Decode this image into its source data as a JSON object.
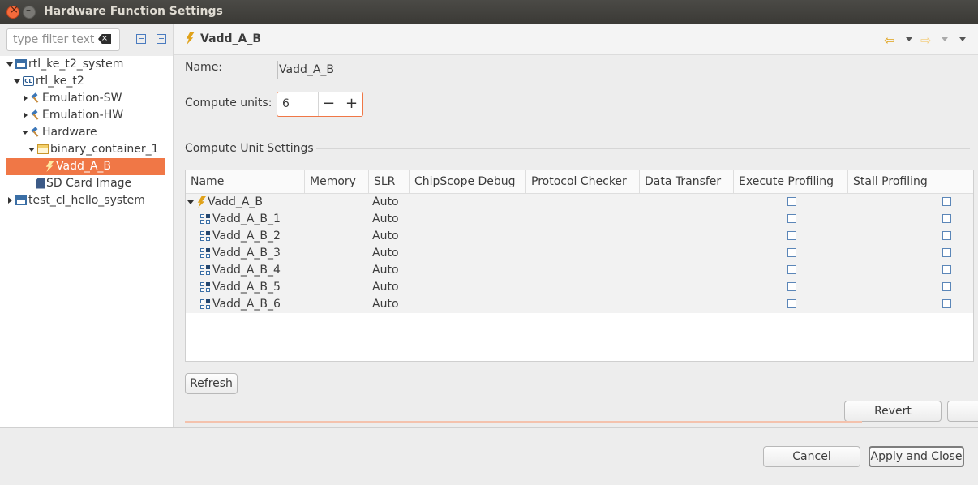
{
  "window": {
    "title": "Hardware Function Settings"
  },
  "filter": {
    "placeholder": "type filter text"
  },
  "tree": [
    {
      "label": "rtl_ke_t2_system",
      "icon": "system-icon",
      "state": "open"
    },
    {
      "label": "rtl_ke_t2",
      "icon": "project-icon",
      "state": "open"
    },
    {
      "label": "Emulation-SW",
      "icon": "hammer-icon",
      "state": "closed"
    },
    {
      "label": "Emulation-HW",
      "icon": "hammer-icon",
      "state": "closed"
    },
    {
      "label": "Hardware",
      "icon": "hammer-icon",
      "state": "open"
    },
    {
      "label": "binary_container_1",
      "icon": "container-icon",
      "state": "open"
    },
    {
      "label": "Vadd_A_B",
      "icon": "bolt-icon",
      "state": "leaf",
      "selected": true
    },
    {
      "label": "SD Card Image",
      "icon": "sd-card-icon",
      "state": "leaf"
    },
    {
      "label": "test_cl_hello_system",
      "icon": "system-icon",
      "state": "closed"
    }
  ],
  "header": {
    "title": "Vadd_A_B"
  },
  "form": {
    "name_label": "Name:",
    "name_value": "Vadd_A_B",
    "compute_units_label": "Compute units:",
    "compute_units_value": "6",
    "minus": "−",
    "plus": "+"
  },
  "section": {
    "title": "Compute Unit Settings"
  },
  "grid": {
    "columns": [
      "Name",
      "Memory",
      "SLR",
      "ChipScope Debug",
      "Protocol Checker",
      "Data Transfer",
      "Execute Profiling",
      "Stall Profiling"
    ],
    "rows": [
      {
        "name": "Vadd_A_B",
        "slr": "Auto",
        "parent": true
      },
      {
        "name": "Vadd_A_B_1",
        "slr": "Auto"
      },
      {
        "name": "Vadd_A_B_2",
        "slr": "Auto"
      },
      {
        "name": "Vadd_A_B_3",
        "slr": "Auto"
      },
      {
        "name": "Vadd_A_B_4",
        "slr": "Auto"
      },
      {
        "name": "Vadd_A_B_5",
        "slr": "Auto"
      },
      {
        "name": "Vadd_A_B_6",
        "slr": "Auto"
      }
    ]
  },
  "buttons": {
    "refresh": "Refresh",
    "revert": "Revert",
    "cancel": "Cancel",
    "apply_close": "Apply and Close"
  },
  "colors": {
    "accent": "#f07746",
    "titlebar": "#3d3c38",
    "link_blue": "#3a6ea5"
  }
}
